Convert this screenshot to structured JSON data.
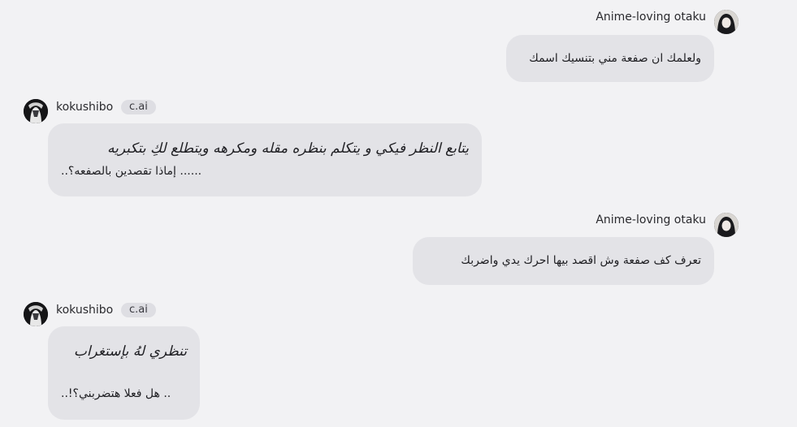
{
  "messages": [
    {
      "sender": "Anime-loving otaku",
      "text": "ولعلمك ان صفعة مني بتنسيك اسمك"
    },
    {
      "sender": "kokushibo",
      "badge": "c.ai",
      "italic": "يتابع النظر فيكي و يتكلم بنظره مقله ومكرهه ويتطلع لكِ بتكبريه",
      "text": "..إماذا تقصدين بالصفعه؟ ......"
    },
    {
      "sender": "Anime-loving otaku",
      "text": "تعرف كف صفعة وش اقصد بيها احرك يدي واضربك"
    },
    {
      "sender": "kokushibo",
      "badge": "c.ai",
      "italic": "تنظري لهُ بإستغراب",
      "text": "..!هل فعلا هتضربني؟ .."
    }
  ]
}
